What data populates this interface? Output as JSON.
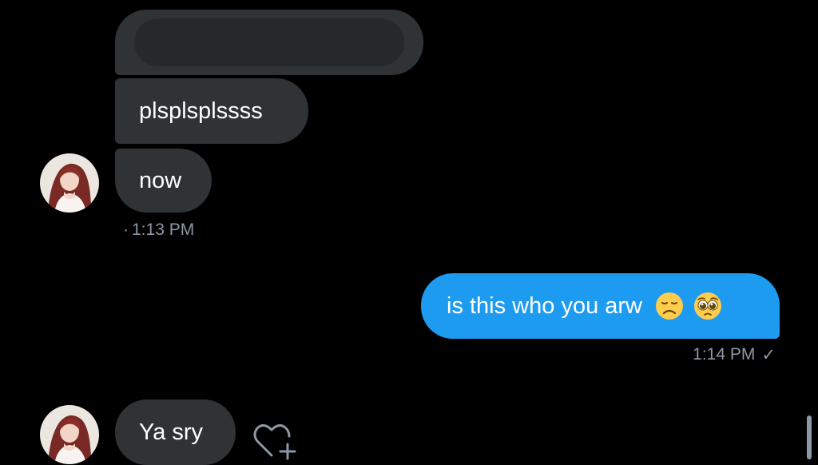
{
  "conversation": {
    "messages": [
      {
        "sender": "them",
        "text": "",
        "redacted": true
      },
      {
        "sender": "them",
        "text": "plsplsplssss"
      },
      {
        "sender": "them",
        "text": "now"
      },
      {
        "sender": "me",
        "text": "is this who you arw",
        "emojis": [
          "disappointed-face",
          "pleading-face"
        ]
      },
      {
        "sender": "them",
        "text": "Ya sry"
      }
    ],
    "timestamps": {
      "received": "1:13 PM",
      "received_dot": "·",
      "sent": "1:14 PM",
      "sent_status": "✓"
    }
  },
  "colors": {
    "background": "#000000",
    "received_bubble": "#2f3336",
    "sent_bubble": "#1d9bf0",
    "timestamp": "#8b98a5"
  },
  "icons": {
    "react": "heart-plus-icon",
    "read_receipt": "check-icon"
  }
}
